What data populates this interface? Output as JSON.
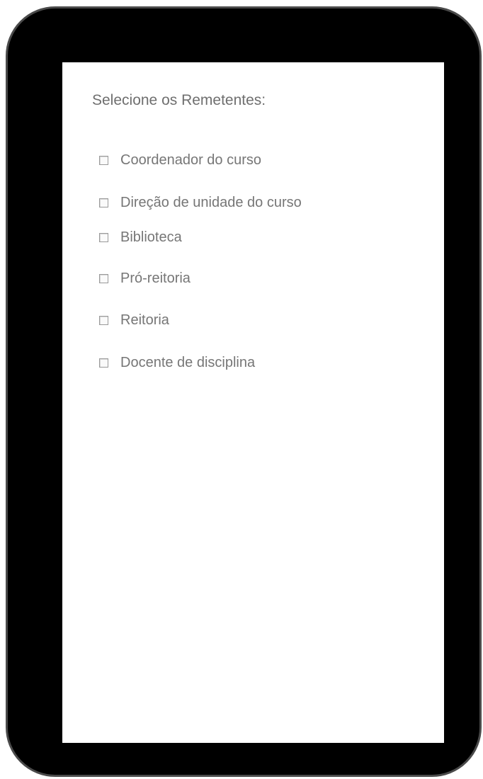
{
  "form": {
    "heading": "Selecione os Remetentes:",
    "options": [
      {
        "label": "Coordenador do curso",
        "checked": false
      },
      {
        "label": "Direção de unidade do curso",
        "checked": false
      },
      {
        "label": "Biblioteca",
        "checked": false
      },
      {
        "label": "Pró-reitoria",
        "checked": false
      },
      {
        "label": "Reitoria",
        "checked": false
      },
      {
        "label": "Docente de disciplina",
        "checked": false
      }
    ]
  },
  "colors": {
    "device_frame": "#000000",
    "device_border": "#4a4a4a",
    "screen_background": "#ffffff",
    "text": "#767676"
  }
}
